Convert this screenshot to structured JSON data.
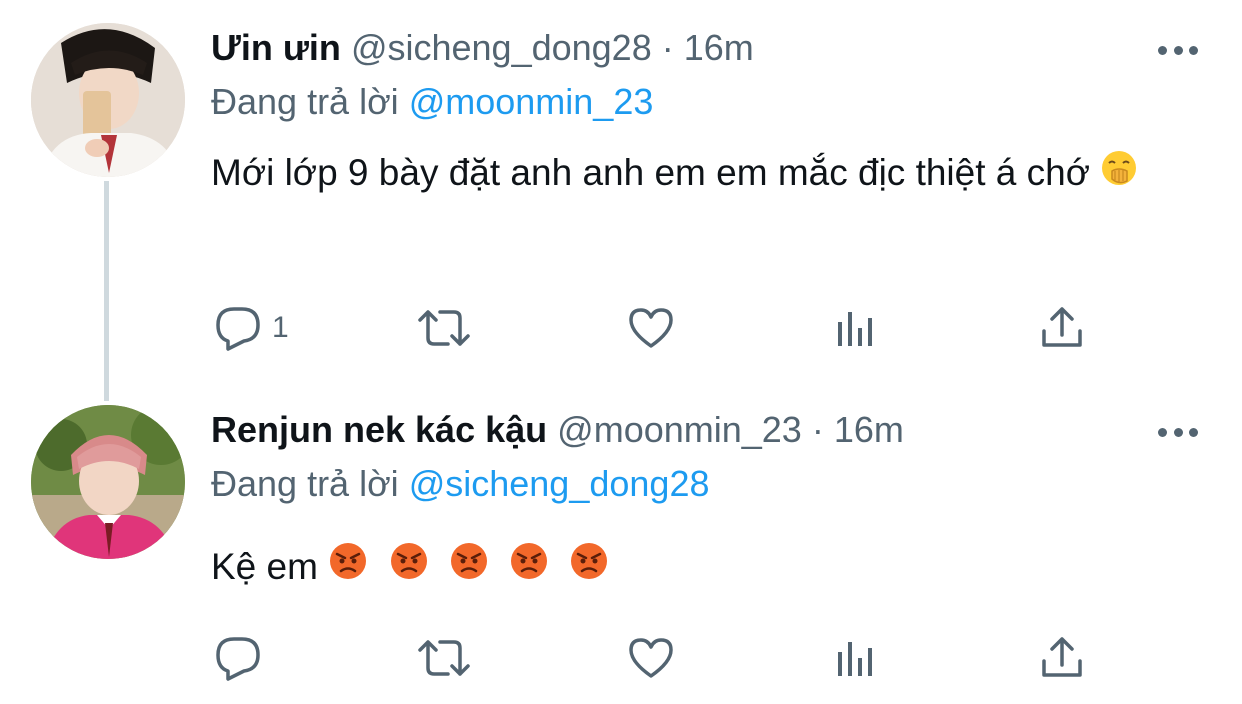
{
  "tweets": [
    {
      "display_name": "Ưin ưin",
      "handle": "@sicheng_dong28",
      "separator": "·",
      "time": "16m",
      "replying_prefix": "Đang trả lời",
      "replying_to": "@moonmin_23",
      "text": "Mới lớp 9 bày đặt anh anh em em mắc địc thiệt á chớ",
      "emojis": [
        "face-with-hand-over-mouth"
      ],
      "reply_count": "1"
    },
    {
      "display_name": "Renjun nek kác kậu",
      "handle": "@moonmin_23",
      "separator": "·",
      "time": "16m",
      "replying_prefix": "Đang trả lời",
      "replying_to": "@sicheng_dong28",
      "text": "Kệ em",
      "emojis": [
        "pouting-face",
        "pouting-face",
        "pouting-face",
        "pouting-face",
        "pouting-face"
      ],
      "reply_count": ""
    }
  ],
  "icons": {
    "reply": "reply-icon",
    "retweet": "retweet-icon",
    "like": "heart-icon",
    "analytics": "analytics-icon",
    "share": "share-icon",
    "more": "more-options-icon"
  },
  "colors": {
    "text": "#0f1419",
    "secondary": "#536471",
    "link": "#1d9bf0",
    "thread_line": "#cfd9de"
  }
}
